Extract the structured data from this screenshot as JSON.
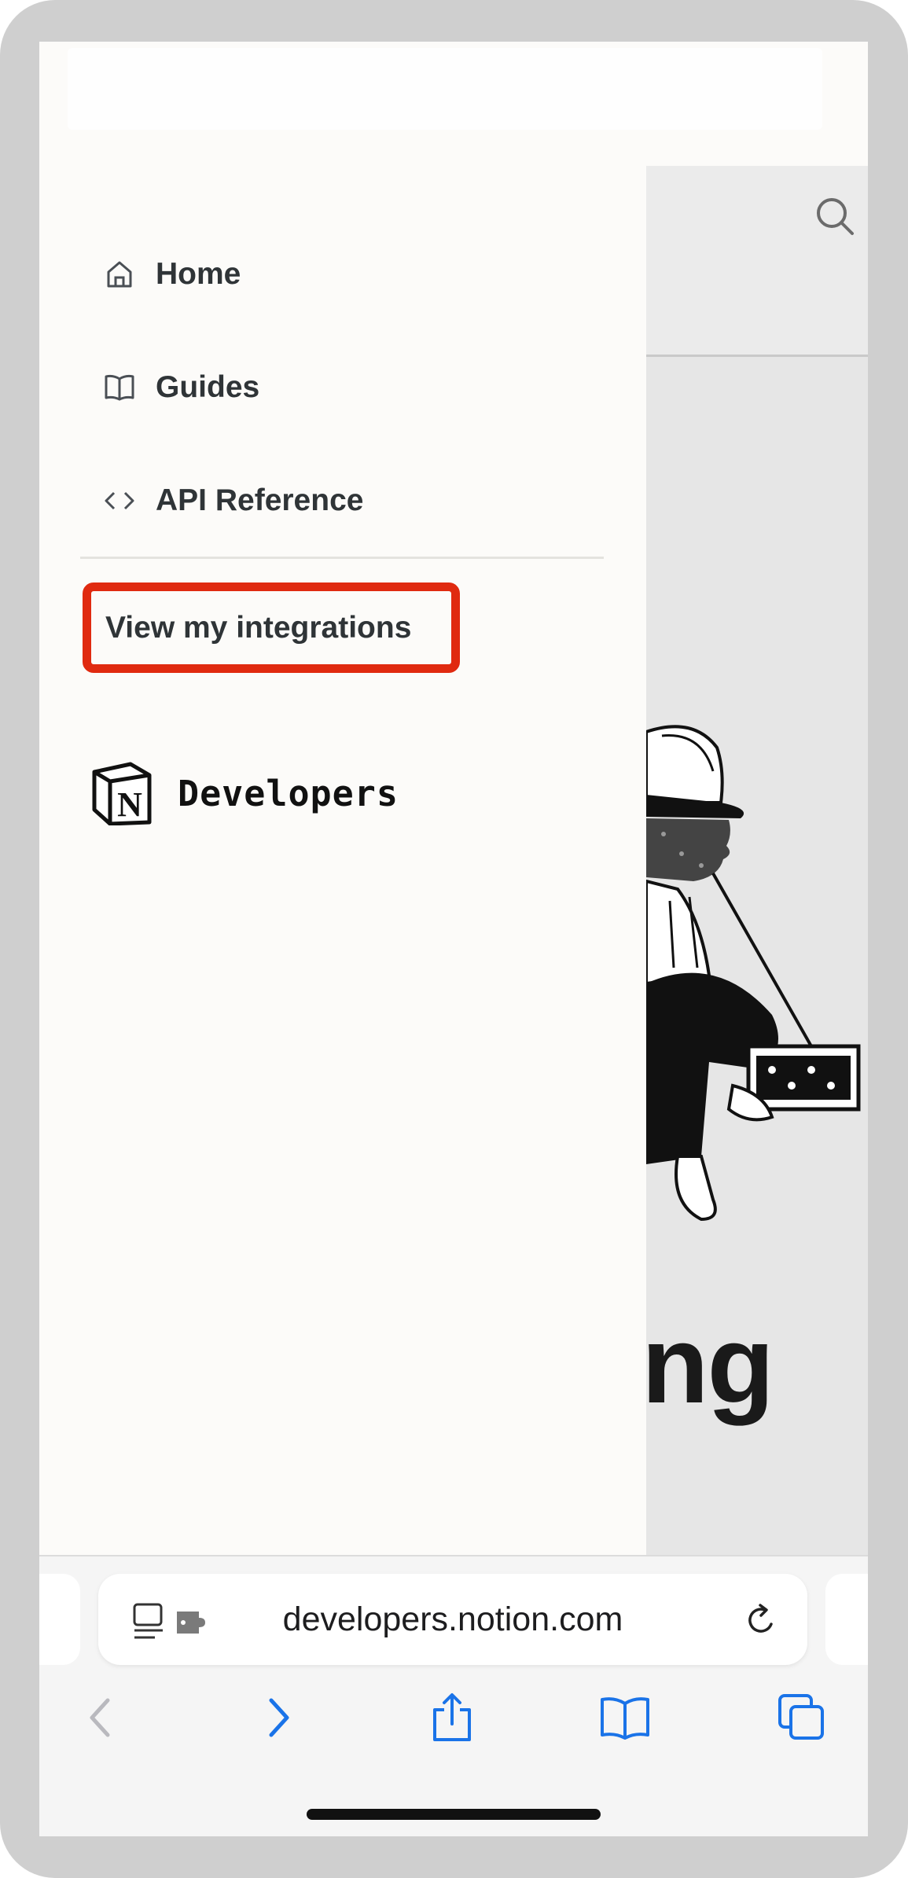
{
  "drawer": {
    "nav": [
      {
        "label": "Home",
        "icon": "home-icon"
      },
      {
        "label": "Guides",
        "icon": "book-icon"
      },
      {
        "label": "API Reference",
        "icon": "code-icon"
      }
    ],
    "integrations_label": "View my integrations",
    "brand_text": "Developers",
    "brand_logo": "notion-logo"
  },
  "page": {
    "hero_text_fragment": "ng"
  },
  "browser": {
    "url": "developers.notion.com",
    "toolbar": [
      "back-icon",
      "forward-icon",
      "share-icon",
      "bookmarks-icon",
      "tabs-icon"
    ]
  },
  "colors": {
    "highlight": "#e02a10",
    "accent": "#1a73e8",
    "drawer_bg": "#fcfbf9",
    "page_bg": "#e6e6e6"
  }
}
